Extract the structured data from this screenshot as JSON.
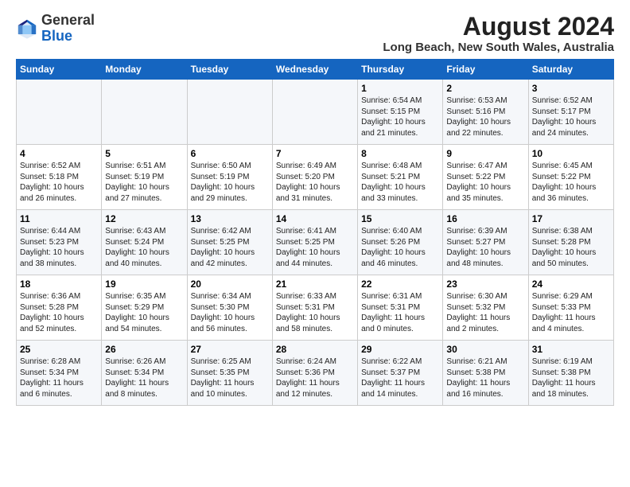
{
  "logo": {
    "text_general": "General",
    "text_blue": "Blue"
  },
  "header": {
    "month_year": "August 2024",
    "location": "Long Beach, New South Wales, Australia"
  },
  "weekdays": [
    "Sunday",
    "Monday",
    "Tuesday",
    "Wednesday",
    "Thursday",
    "Friday",
    "Saturday"
  ],
  "rows": [
    [
      {
        "day": "",
        "content": ""
      },
      {
        "day": "",
        "content": ""
      },
      {
        "day": "",
        "content": ""
      },
      {
        "day": "",
        "content": ""
      },
      {
        "day": "1",
        "content": "Sunrise: 6:54 AM\nSunset: 5:15 PM\nDaylight: 10 hours\nand 21 minutes."
      },
      {
        "day": "2",
        "content": "Sunrise: 6:53 AM\nSunset: 5:16 PM\nDaylight: 10 hours\nand 22 minutes."
      },
      {
        "day": "3",
        "content": "Sunrise: 6:52 AM\nSunset: 5:17 PM\nDaylight: 10 hours\nand 24 minutes."
      }
    ],
    [
      {
        "day": "4",
        "content": "Sunrise: 6:52 AM\nSunset: 5:18 PM\nDaylight: 10 hours\nand 26 minutes."
      },
      {
        "day": "5",
        "content": "Sunrise: 6:51 AM\nSunset: 5:19 PM\nDaylight: 10 hours\nand 27 minutes."
      },
      {
        "day": "6",
        "content": "Sunrise: 6:50 AM\nSunset: 5:19 PM\nDaylight: 10 hours\nand 29 minutes."
      },
      {
        "day": "7",
        "content": "Sunrise: 6:49 AM\nSunset: 5:20 PM\nDaylight: 10 hours\nand 31 minutes."
      },
      {
        "day": "8",
        "content": "Sunrise: 6:48 AM\nSunset: 5:21 PM\nDaylight: 10 hours\nand 33 minutes."
      },
      {
        "day": "9",
        "content": "Sunrise: 6:47 AM\nSunset: 5:22 PM\nDaylight: 10 hours\nand 35 minutes."
      },
      {
        "day": "10",
        "content": "Sunrise: 6:45 AM\nSunset: 5:22 PM\nDaylight: 10 hours\nand 36 minutes."
      }
    ],
    [
      {
        "day": "11",
        "content": "Sunrise: 6:44 AM\nSunset: 5:23 PM\nDaylight: 10 hours\nand 38 minutes."
      },
      {
        "day": "12",
        "content": "Sunrise: 6:43 AM\nSunset: 5:24 PM\nDaylight: 10 hours\nand 40 minutes."
      },
      {
        "day": "13",
        "content": "Sunrise: 6:42 AM\nSunset: 5:25 PM\nDaylight: 10 hours\nand 42 minutes."
      },
      {
        "day": "14",
        "content": "Sunrise: 6:41 AM\nSunset: 5:25 PM\nDaylight: 10 hours\nand 44 minutes."
      },
      {
        "day": "15",
        "content": "Sunrise: 6:40 AM\nSunset: 5:26 PM\nDaylight: 10 hours\nand 46 minutes."
      },
      {
        "day": "16",
        "content": "Sunrise: 6:39 AM\nSunset: 5:27 PM\nDaylight: 10 hours\nand 48 minutes."
      },
      {
        "day": "17",
        "content": "Sunrise: 6:38 AM\nSunset: 5:28 PM\nDaylight: 10 hours\nand 50 minutes."
      }
    ],
    [
      {
        "day": "18",
        "content": "Sunrise: 6:36 AM\nSunset: 5:28 PM\nDaylight: 10 hours\nand 52 minutes."
      },
      {
        "day": "19",
        "content": "Sunrise: 6:35 AM\nSunset: 5:29 PM\nDaylight: 10 hours\nand 54 minutes."
      },
      {
        "day": "20",
        "content": "Sunrise: 6:34 AM\nSunset: 5:30 PM\nDaylight: 10 hours\nand 56 minutes."
      },
      {
        "day": "21",
        "content": "Sunrise: 6:33 AM\nSunset: 5:31 PM\nDaylight: 10 hours\nand 58 minutes."
      },
      {
        "day": "22",
        "content": "Sunrise: 6:31 AM\nSunset: 5:31 PM\nDaylight: 11 hours\nand 0 minutes."
      },
      {
        "day": "23",
        "content": "Sunrise: 6:30 AM\nSunset: 5:32 PM\nDaylight: 11 hours\nand 2 minutes."
      },
      {
        "day": "24",
        "content": "Sunrise: 6:29 AM\nSunset: 5:33 PM\nDaylight: 11 hours\nand 4 minutes."
      }
    ],
    [
      {
        "day": "25",
        "content": "Sunrise: 6:28 AM\nSunset: 5:34 PM\nDaylight: 11 hours\nand 6 minutes."
      },
      {
        "day": "26",
        "content": "Sunrise: 6:26 AM\nSunset: 5:34 PM\nDaylight: 11 hours\nand 8 minutes."
      },
      {
        "day": "27",
        "content": "Sunrise: 6:25 AM\nSunset: 5:35 PM\nDaylight: 11 hours\nand 10 minutes."
      },
      {
        "day": "28",
        "content": "Sunrise: 6:24 AM\nSunset: 5:36 PM\nDaylight: 11 hours\nand 12 minutes."
      },
      {
        "day": "29",
        "content": "Sunrise: 6:22 AM\nSunset: 5:37 PM\nDaylight: 11 hours\nand 14 minutes."
      },
      {
        "day": "30",
        "content": "Sunrise: 6:21 AM\nSunset: 5:38 PM\nDaylight: 11 hours\nand 16 minutes."
      },
      {
        "day": "31",
        "content": "Sunrise: 6:19 AM\nSunset: 5:38 PM\nDaylight: 11 hours\nand 18 minutes."
      }
    ]
  ]
}
